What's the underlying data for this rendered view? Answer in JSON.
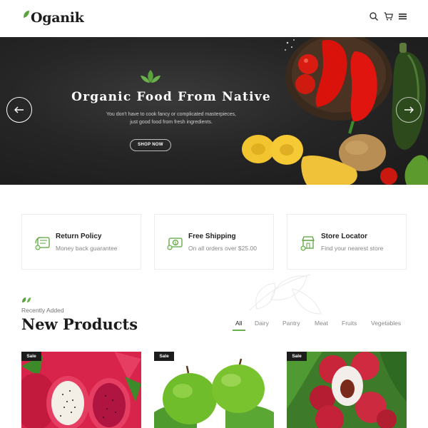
{
  "header": {
    "logo": "Oganik",
    "icons": [
      "search-icon",
      "cart-icon",
      "menu-icon"
    ]
  },
  "hero": {
    "title": "Organic Food From Native",
    "subtitle_line1": "You don't have to cook fancy or complicated masterpieces,",
    "subtitle_line2": "just good food from fresh ingredients.",
    "button": "SHOP NOW",
    "prev_icon": "arrow-left-icon",
    "next_icon": "arrow-right-icon"
  },
  "features": [
    {
      "title": "Return Policy",
      "subtitle": "Money back guarantee",
      "icon": "return-box-icon"
    },
    {
      "title": "Free Shipping",
      "subtitle": "On all orders over $25.00",
      "icon": "shipping-icon"
    },
    {
      "title": "Store Locator",
      "subtitle": "Find your nearest store",
      "icon": "store-icon"
    }
  ],
  "section": {
    "eyebrow": "Recently Added",
    "title": "New Products"
  },
  "filters": [
    "All",
    "Dairy",
    "Pantry",
    "Meat",
    "Fruits",
    "Vegetables"
  ],
  "active_filter": "All",
  "products": [
    {
      "badge": "Sale",
      "image": "dragon-fruit"
    },
    {
      "badge": "Sale",
      "image": "green-apples"
    },
    {
      "badge": "Sale",
      "image": "lychee"
    }
  ],
  "colors": {
    "accent": "#6ab04c",
    "dark": "#1c1c1c",
    "hero_bg": "#262626"
  }
}
